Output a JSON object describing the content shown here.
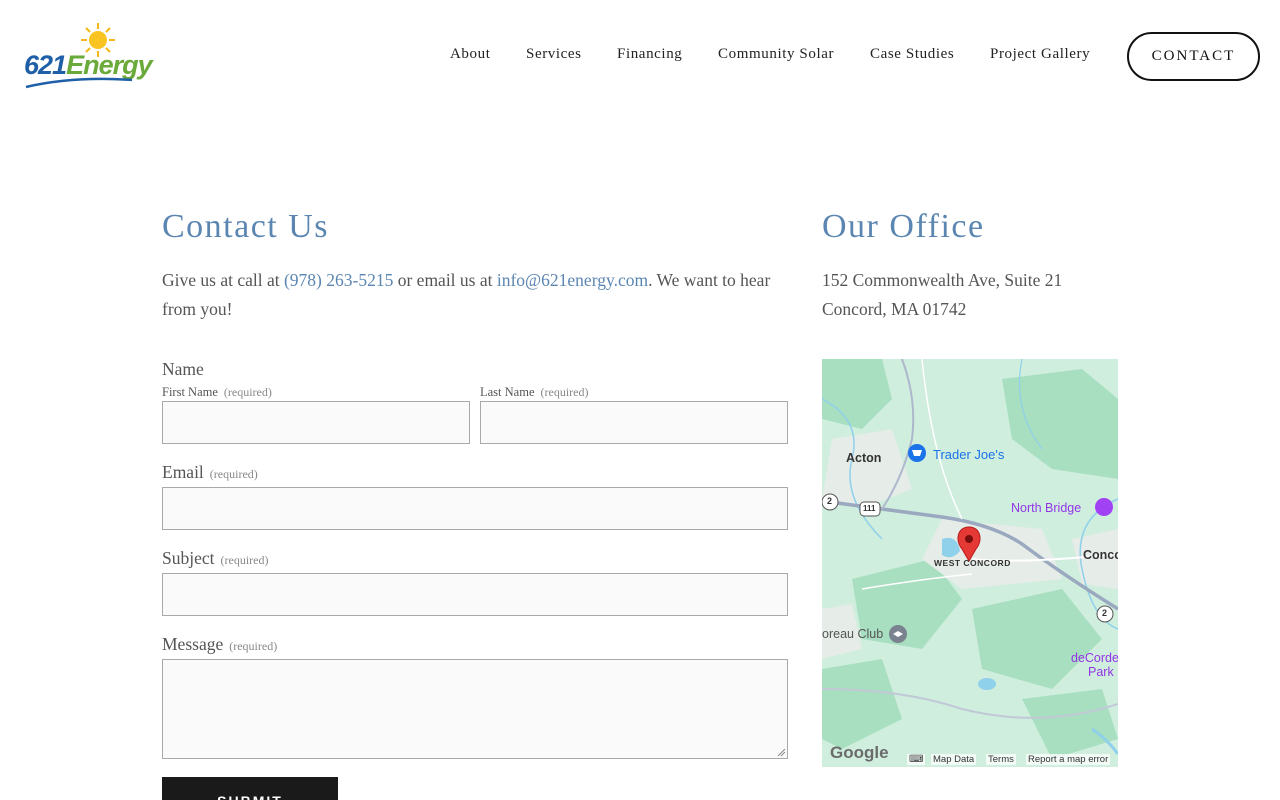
{
  "brand": {
    "logo_number": "621",
    "logo_word": "Energy"
  },
  "nav": {
    "items": [
      "About",
      "Services",
      "Financing",
      "Community Solar",
      "Case Studies",
      "Project Gallery"
    ],
    "contact_label": "CONTACT"
  },
  "contact": {
    "title": "Contact Us",
    "intro_prefix": "Give us at call at ",
    "phone": "(978) 263-5215",
    "intro_middle": " or email us at ",
    "email": "info@621energy.com",
    "intro_suffix": ". We want to hear from you!"
  },
  "form": {
    "name_label": "Name",
    "first_name_label": "First Name",
    "last_name_label": "Last Name",
    "required_tag": "(required)",
    "email_label": "Email",
    "subject_label": "Subject",
    "message_label": "Message",
    "submit_label": "SUBMIT"
  },
  "office": {
    "title": "Our Office",
    "address_line1": "152 Commonwealth Ave, Suite 21",
    "address_line2": "Concord, MA 01742"
  },
  "map": {
    "labels": {
      "acton": "Acton",
      "trader_joes": "Trader Joe's",
      "north_bridge": "North Bridge",
      "concord": "Conco",
      "west_concord": "WEST CONCORD",
      "thoreau_club": "oreau Club",
      "decordova": "deCorde",
      "park": "Park",
      "route_2a": "2",
      "route_111": "111",
      "route_2b": "2"
    },
    "google": "Google",
    "map_data": "Map Data",
    "terms": "Terms",
    "report": "Report a map error",
    "colors": {
      "land": "#cfeede",
      "park": "#a8dfc0",
      "water": "#8fd0ea",
      "road": "#9aa8c0",
      "pin": "#e53935"
    }
  },
  "colors": {
    "accent": "#5b86b2",
    "text": "#555555",
    "button": "#1a1a1a"
  }
}
